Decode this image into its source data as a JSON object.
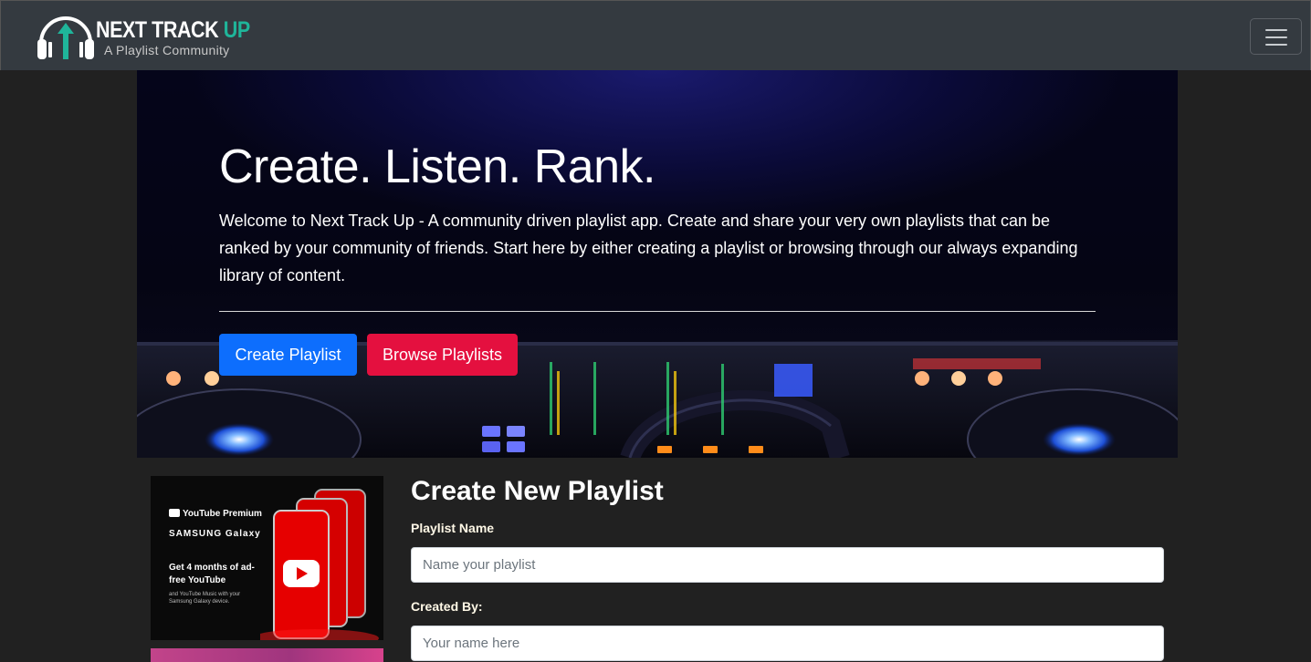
{
  "navbar": {
    "brand_title_main": "NEXT TRACK ",
    "brand_title_accent": "UP",
    "brand_subtitle": "A Playlist Community",
    "toggler_icon": "hamburger-icon",
    "colors": {
      "background": "#343a40",
      "accent": "#1fb59a"
    }
  },
  "hero": {
    "title": "Create. Listen. Rank.",
    "lead": "Welcome to Next Track Up - A community driven playlist app. Create and share your very own playlists that can be ranked by your community of friends. Start here by either creating a playlist or browsing through our always expanding library of content.",
    "buttons": {
      "create_label": "Create Playlist",
      "browse_label": "Browse Playlists"
    },
    "colors": {
      "create": "#0d6efd",
      "browse": "#e4103f"
    }
  },
  "ad": {
    "brand": "YouTube Premium",
    "partner": "SAMSUNG Galaxy",
    "headline": "Get 4 months of ad-free YouTube",
    "fine_print": "and YouTube Music with your Samsung Galaxy device."
  },
  "form": {
    "title": "Create New Playlist",
    "playlist_name_label": "Playlist Name",
    "playlist_name_placeholder": "Name your playlist",
    "created_by_label": "Created By:",
    "created_by_placeholder": "Your name here"
  }
}
